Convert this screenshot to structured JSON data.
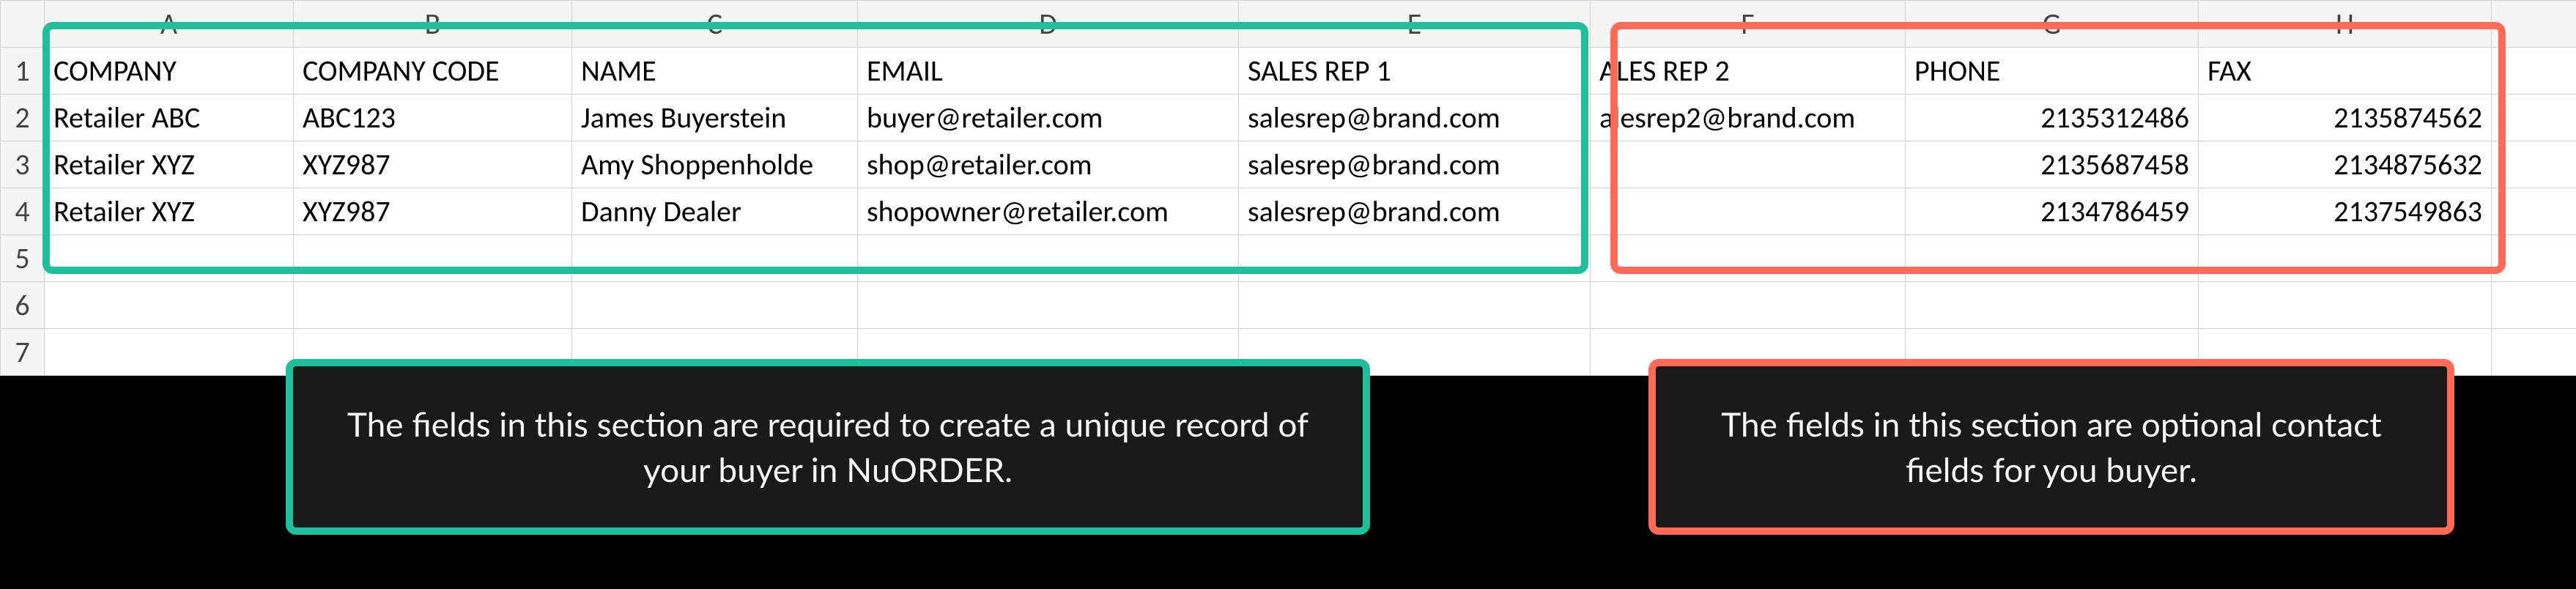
{
  "columns": {
    "A": "A",
    "B": "B",
    "C": "C",
    "D": "D",
    "E": "E",
    "F": "F",
    "G": "G",
    "H": "H"
  },
  "row_labels": [
    "1",
    "2",
    "3",
    "4",
    "5",
    "6",
    "7"
  ],
  "header_row": {
    "company": "COMPANY",
    "company_code": "COMPANY CODE",
    "name": "NAME",
    "email": "EMAIL",
    "sales_rep_1": "SALES REP 1",
    "sales_rep_2_clipped": "ALES REP 2",
    "phone": "PHONE",
    "fax": "FAX"
  },
  "rows": [
    {
      "company": "Retailer ABC",
      "company_code": "ABC123",
      "name": "James Buyerstein",
      "email": "buyer@retailer.com",
      "sales_rep_1": "salesrep@brand.com",
      "sales_rep_2_clipped": "alesrep2@brand.com",
      "phone": "2135312486",
      "fax": "2135874562"
    },
    {
      "company": "Retailer XYZ",
      "company_code": "XYZ987",
      "name": "Amy Shoppenholde",
      "email": "shop@retailer.com",
      "sales_rep_1": "salesrep@brand.com",
      "sales_rep_2_clipped": "",
      "phone": "2135687458",
      "fax": "2134875632"
    },
    {
      "company": "Retailer XYZ",
      "company_code": "XYZ987",
      "name": "Danny Dealer",
      "email": "shopowner@retailer.com",
      "sales_rep_1": "salesrep@brand.com",
      "sales_rep_2_clipped": "",
      "phone": "2134786459",
      "fax": "2137549863"
    }
  ],
  "annotations": {
    "required": "The fields in this section are required to create a unique record of your buyer in NuORDER.",
    "optional": "The fields in this section are optional contact fields for you buyer."
  },
  "highlight_colors": {
    "required": "#1fbf9c",
    "optional": "#ff6b57"
  }
}
